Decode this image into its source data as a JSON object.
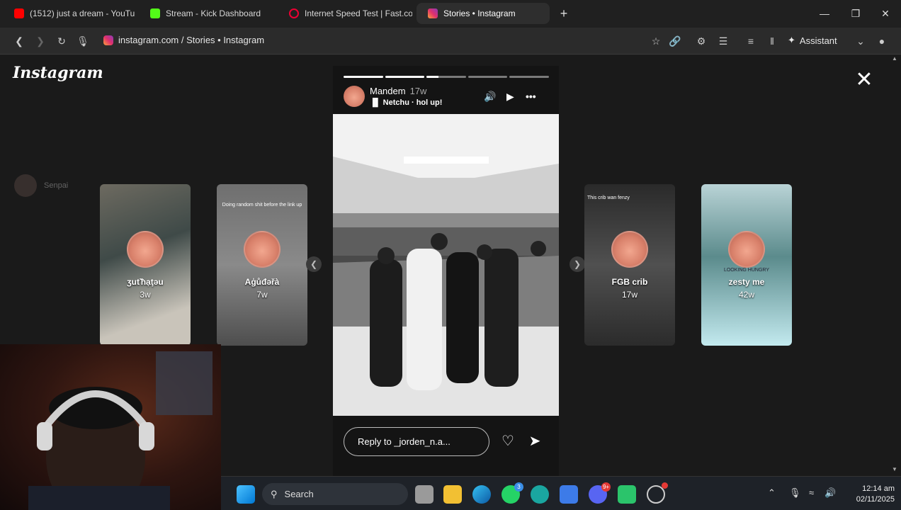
{
  "tabs": [
    {
      "title": "(1512) just a dream - YouTube",
      "icon": "youtube-icon"
    },
    {
      "title": "Stream - Kick Dashboard",
      "icon": "kick-icon"
    },
    {
      "title": "Internet Speed Test | Fast.com",
      "icon": "fast-icon"
    },
    {
      "title": "Stories • Instagram",
      "icon": "instagram-icon"
    }
  ],
  "address": {
    "url": "instagram.com / Stories • Instagram"
  },
  "toolbar": {
    "assistant_label": "Assistant"
  },
  "page": {
    "logo": "Instagram",
    "side_user": "Senpai",
    "stories": [
      {
        "name": "ʒuťħạţəu",
        "age": "3w"
      },
      {
        "name": "Aģůđəřà",
        "age": "7w",
        "caption": "Doing random shit before the link up"
      },
      {
        "name": "FGB crib",
        "age": "17w",
        "caption": "This crib wan fenzy"
      },
      {
        "name": "zesty me",
        "age": "42w",
        "caption": "LOOKING HUNGRY"
      }
    ],
    "active_story": {
      "user": "Mandem",
      "time": "17w",
      "music": "Netchu · hol up!",
      "progress": [
        1,
        1,
        0.3,
        0,
        0
      ],
      "reply_placeholder": "Reply to _jorden_n.a..."
    }
  },
  "taskbar": {
    "search_label": "Search",
    "time": "12:14 am",
    "date": "02/11/2025",
    "whatsapp_badge": "3",
    "discord_badge": "9+"
  },
  "colors": {
    "accent": "#e1306c",
    "taskbar": "#1e2228"
  }
}
